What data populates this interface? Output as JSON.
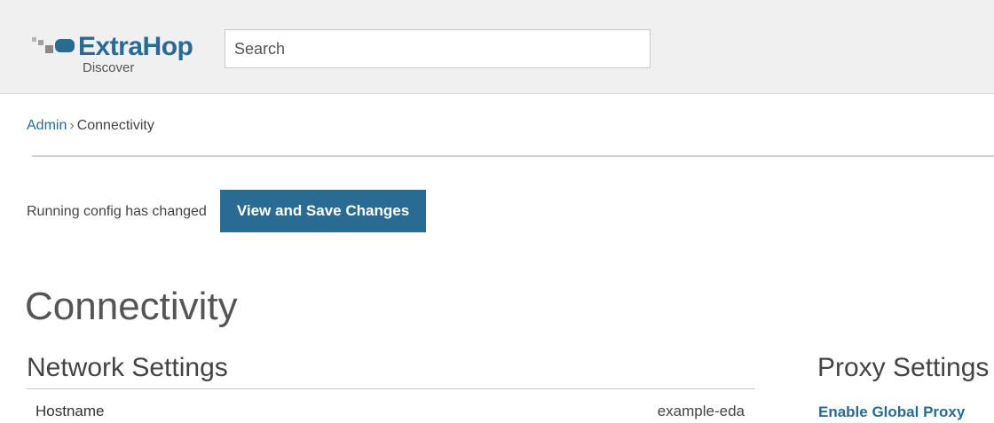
{
  "header": {
    "logo": {
      "name": "ExtraHop",
      "product": "Discover",
      "icon": "extrahop-logo-icon"
    },
    "search": {
      "placeholder": "Search",
      "value": ""
    }
  },
  "breadcrumb": {
    "parent": "Admin",
    "separator": "›",
    "current": "Connectivity"
  },
  "notice": {
    "text": "Running config has changed",
    "button_label": "View and Save Changes"
  },
  "page": {
    "title": "Connectivity"
  },
  "network_settings": {
    "title": "Network Settings",
    "rows": [
      {
        "label": "Hostname",
        "value": "example-eda"
      }
    ]
  },
  "proxy_settings": {
    "title": "Proxy Settings",
    "link": "Enable Global Proxy"
  },
  "colors": {
    "accent": "#2a6b93",
    "header_bg": "#f0f0f0"
  }
}
